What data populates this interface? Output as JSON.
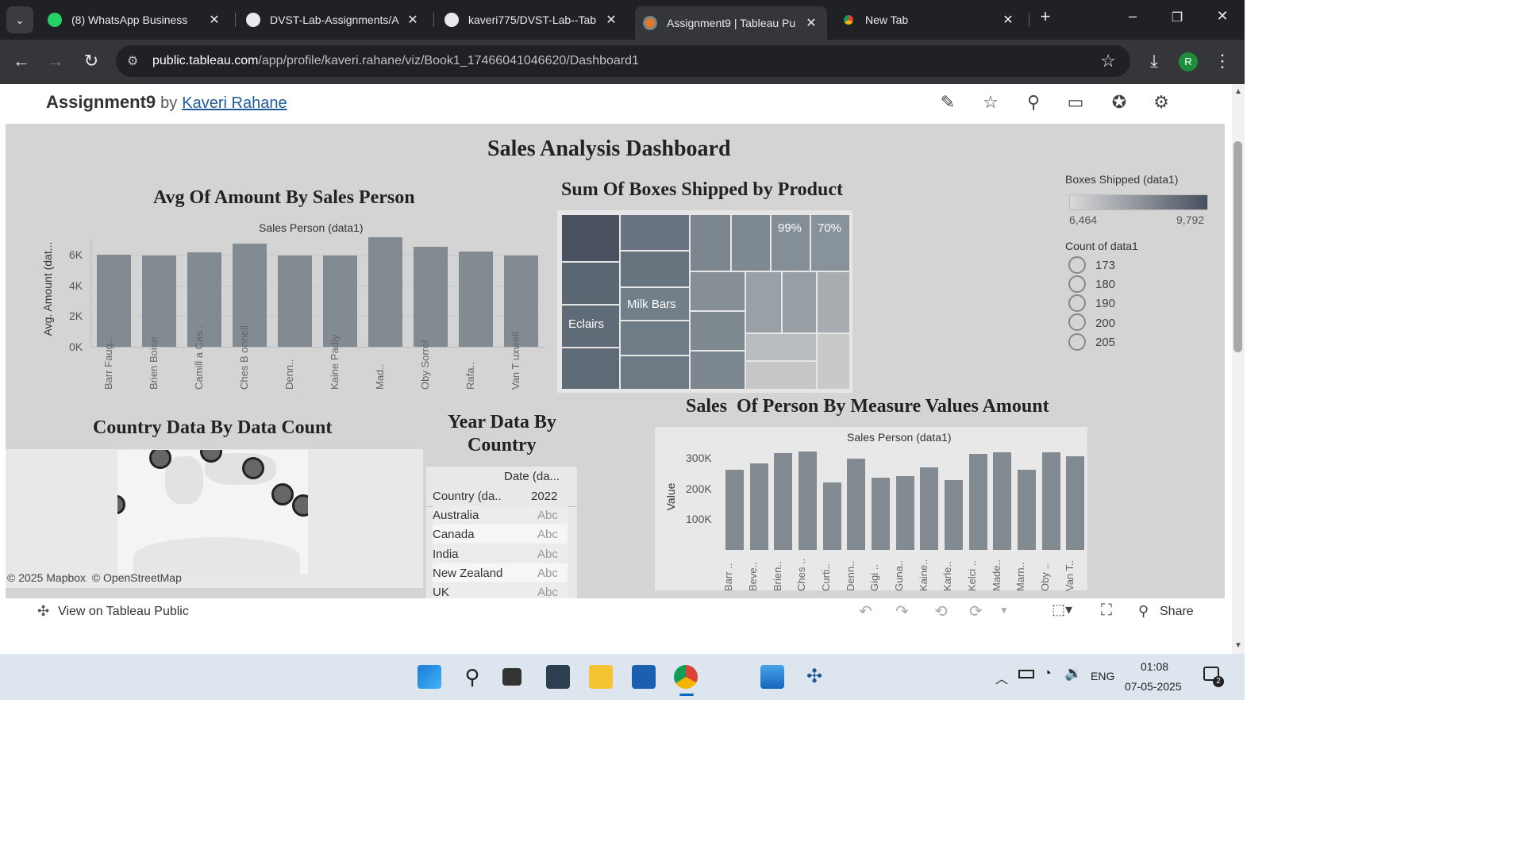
{
  "browser": {
    "tabs": [
      {
        "title": "(8) WhatsApp Business",
        "icon": "whatsapp-icon"
      },
      {
        "title": "DVST-Lab-Assignments/A",
        "icon": "github-icon"
      },
      {
        "title": "kaveri775/DVST-Lab--Tab",
        "icon": "github-icon"
      },
      {
        "title": "Assignment9 | Tableau Pu",
        "icon": "tableau-icon",
        "active": true
      },
      {
        "title": "New Tab",
        "icon": "chrome-icon"
      }
    ],
    "url_host": "public.tableau.com",
    "url_path": "/app/profile/kaveri.rahane/viz/Book1_17466041046620/Dashboard1",
    "profile_initial": "R"
  },
  "viz": {
    "title": "Assignment9",
    "by": "by",
    "author": "Kaveri Rahane"
  },
  "dashboard": {
    "title": "Sales Analysis Dashboard",
    "legend": {
      "color_title": "Boxes Shipped (data1)",
      "color_min": "6,464",
      "color_max": "9,792",
      "size_title": "Count of data1",
      "sizes": [
        "173",
        "180",
        "190",
        "200",
        "205"
      ]
    },
    "treemap": {
      "title": "Sum Of Boxes Shipped by Product",
      "labels": {
        "a": "99%",
        "b": "70%",
        "milk": "Milk Bars",
        "eclairs": "Eclairs"
      }
    },
    "map": {
      "title": "Country Data By Data Count",
      "attribution": "© 2025 Mapbox  © OpenStreetMap"
    },
    "table": {
      "title_line1": "Year Data By",
      "title_line2": "Country",
      "col_header": "Date (da...",
      "row_header": "Country (da..",
      "year": "2022",
      "rows": [
        {
          "country": "Australia",
          "value": "Abc"
        },
        {
          "country": "Canada",
          "value": "Abc"
        },
        {
          "country": "India",
          "value": "Abc"
        },
        {
          "country": "New Zealand",
          "value": "Abc"
        },
        {
          "country": "UK",
          "value": "Abc"
        }
      ]
    }
  },
  "chart_data": [
    {
      "type": "bar",
      "title": "Avg Of Amount By Sales Person",
      "header": "Sales Person (data1)",
      "ylabel": "Avg. Amount (dat...",
      "yticks": [
        "6K",
        "4K",
        "2K",
        "0K"
      ],
      "ylim": [
        0,
        8000
      ],
      "categories": [
        "Barr\nFaug..",
        "Brien\nBoise",
        "Camill\na Cas..",
        "Ches B\nonnell",
        "Denn..",
        "Kaine\nPadly",
        "Mad..",
        "Oby\nSorrel",
        "Rafa..",
        "Van T\nuxwell"
      ],
      "values": [
        6000,
        5950,
        6150,
        6700,
        5950,
        5950,
        7100,
        6500,
        6200,
        5950
      ]
    },
    {
      "type": "bar",
      "title": "Sales  Of Person By Measure Values Amount",
      "header": "Sales Person (data1)",
      "ylabel": "Value",
      "yticks": [
        "300K",
        "200K",
        "100K"
      ],
      "ylim": [
        0,
        350000
      ],
      "categories": [
        "Barr ..",
        "Beve..",
        "Brien..",
        "Ches ..",
        "Curti..",
        "Denn..",
        "Gigi ..",
        "Guna..",
        "Kaine..",
        "Karle..",
        "Kelci ..",
        "Made..",
        "Marn..",
        "Oby ..",
        "Van T.."
      ],
      "values": [
        261000,
        282000,
        316000,
        322000,
        220000,
        297000,
        236000,
        242000,
        270000,
        227000,
        314000,
        319000,
        262000,
        319000,
        305000
      ]
    }
  ],
  "footer": {
    "view_label": "View on Tableau Public",
    "share_label": "Share"
  },
  "taskbar": {
    "lang": "ENG",
    "time": "01:08",
    "date": "07-05-2025",
    "notif_count": "2"
  }
}
